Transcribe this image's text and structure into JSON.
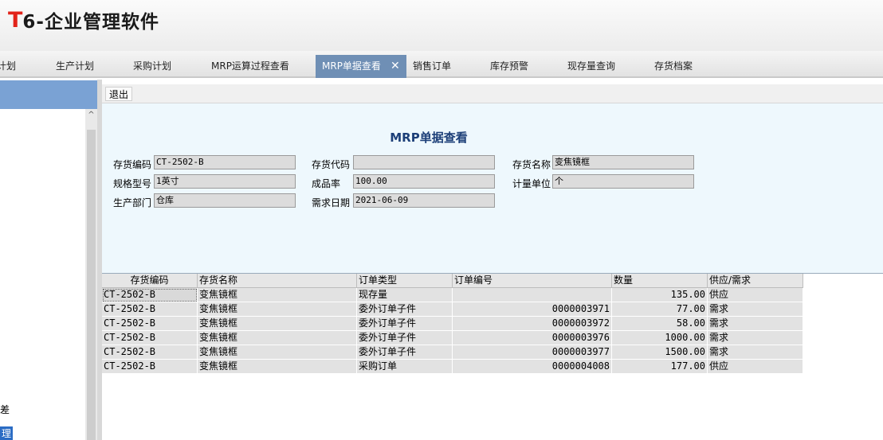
{
  "app": {
    "logo_t": "T",
    "logo_rest": "6-企业管理软件"
  },
  "tabs": [
    {
      "label": "计划"
    },
    {
      "label": "生产计划"
    },
    {
      "label": "采购计划"
    },
    {
      "label": "MRP运算过程查看"
    },
    {
      "label": "MRP单据查看",
      "close": "✕"
    },
    {
      "label": "销售订单"
    },
    {
      "label": "库存预警"
    },
    {
      "label": "现存量查询"
    },
    {
      "label": "存货档案"
    }
  ],
  "leftpanel": {
    "scroll_up": "^",
    "frag1": "差",
    "frag2": "理"
  },
  "toolbar": {
    "exit_label": "退出"
  },
  "form": {
    "title": "MRP单据查看",
    "fields": {
      "code_label": "存货编码",
      "code_value": "CT-2502-B",
      "alias_label": "存货代码",
      "alias_value": "",
      "name_label": "存货名称",
      "name_value": "变焦镜框",
      "spec_label": "规格型号",
      "spec_value": "1英寸",
      "yield_label": "成品率",
      "yield_value": "100.00",
      "unit_label": "计量单位",
      "unit_value": "个",
      "dept_label": "生产部门",
      "dept_value": "仓库",
      "date_label": "需求日期",
      "date_value": "2021-06-09"
    }
  },
  "grid": {
    "headers": [
      "存货编码",
      "存货名称",
      "订单类型",
      "订单编号",
      "数量",
      "供应/需求"
    ],
    "rows": [
      [
        "CT-2502-B",
        "变焦镜框",
        "现存量",
        "",
        "135.00",
        "供应"
      ],
      [
        "CT-2502-B",
        "变焦镜框",
        "委外订单子件",
        "0000003971",
        "77.00",
        "需求"
      ],
      [
        "CT-2502-B",
        "变焦镜框",
        "委外订单子件",
        "0000003972",
        "58.00",
        "需求"
      ],
      [
        "CT-2502-B",
        "变焦镜框",
        "委外订单子件",
        "0000003976",
        "1000.00",
        "需求"
      ],
      [
        "CT-2502-B",
        "变焦镜框",
        "委外订单子件",
        "0000003977",
        "1500.00",
        "需求"
      ],
      [
        "CT-2502-B",
        "变焦镜框",
        "采购订单",
        "0000004008",
        "177.00",
        "供应"
      ]
    ]
  }
}
